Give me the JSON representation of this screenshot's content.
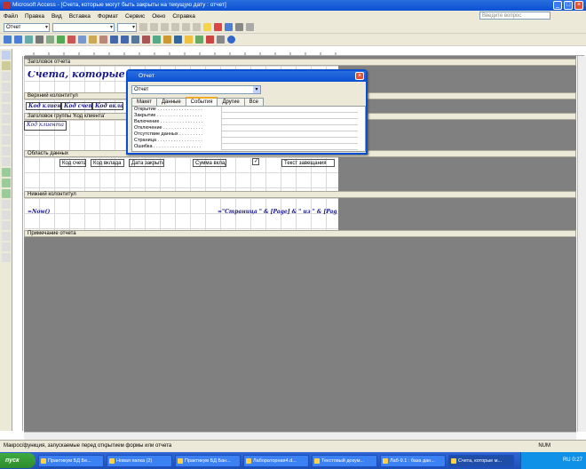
{
  "window": {
    "title": "Microsoft Access - [Счета, которые могут быть закрыты на текущую дату : отчет]"
  },
  "menu": {
    "items": [
      "Файл",
      "Правка",
      "Вид",
      "Вставка",
      "Формат",
      "Сервис",
      "Окно",
      "Справка"
    ],
    "help_placeholder": "Введите вопрос"
  },
  "toolbar": {
    "object_combo": "Отчет"
  },
  "report": {
    "sections": {
      "report_header": "Заголовок отчета",
      "page_header": "Верхний колонтитул",
      "group_header": "Заголовок группы 'Код клиента'",
      "detail": "Область данных",
      "page_footer": "Нижний колонтитул",
      "report_footer": "Примечание отчета"
    },
    "title": "Счета, которые мог",
    "page_header_labels": [
      "Код клиента",
      "Код счета",
      "Код вклада"
    ],
    "group_field": "Код клиента",
    "detail_fields": [
      "Код счета",
      "Код вклада",
      "Дата закрытия",
      "Сумма вклада",
      "Текст завещания"
    ],
    "footer_date": "=Now()",
    "footer_pages": "=\"Страница \" & [Page] & \" из \" & [Pages]"
  },
  "dialog": {
    "title": "Отчет",
    "selector": "Отчет",
    "tabs": [
      "Макет",
      "Данные",
      "События",
      "Другие",
      "Все"
    ],
    "active_tab": "События",
    "properties": [
      "Открытие . . . . . . . . . . . . . . . . .",
      "Закрытие . . . . . . . . . . . . . . . . .",
      "Включение . . . . . . . . . . . . . . . .",
      "Отключение . . . . . . . . . . . . . . .",
      "Отсутствие данных . . . . . . . . .",
      "Страница . . . . . . . . . . . . . . . . .",
      "Ошибка . . . . . . . . . . . . . . . . . ."
    ]
  },
  "status": {
    "text": "Макрос/функция, запускаемые перед открытием формы или отчета",
    "num": "NUM"
  },
  "taskbar": {
    "start": "пуск",
    "tasks": [
      "Практикум БД Бе...",
      "Новая папка (2)",
      "Практикум БД Бан...",
      "Лабораторная4.d...",
      "Текстовый докум...",
      "Лаб-9.1 : база дан...",
      "Счета, которые м..."
    ],
    "lang": "RU",
    "time": "0:27"
  }
}
